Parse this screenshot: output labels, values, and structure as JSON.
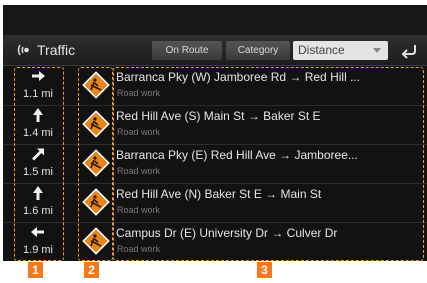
{
  "header": {
    "title": "Traffic",
    "title_icon": "radio-signal-icon",
    "on_route_label": "On Route",
    "category_label": "Category",
    "sort_dropdown": {
      "selected": "Distance"
    },
    "back_icon": "back-arrow-icon"
  },
  "incidents": [
    {
      "direction_icon": "arrow-right-icon",
      "distance": "1.1 mi",
      "road": "Barranca Pky (W) Jamboree Rd → Red Hill ...",
      "type": "Road work",
      "sign_icon": "road-work-sign-icon"
    },
    {
      "direction_icon": "arrow-up-icon",
      "distance": "1.4 mi",
      "road": "Red Hill Ave (S) Main St → Baker St E",
      "type": "Road work",
      "sign_icon": "road-work-sign-icon"
    },
    {
      "direction_icon": "arrow-up-right-icon",
      "distance": "1.5 mi",
      "road": "Barranca Pky (E) Red Hill Ave → Jamboree...",
      "type": "Road work",
      "sign_icon": "road-work-sign-icon"
    },
    {
      "direction_icon": "arrow-up-icon",
      "distance": "1.6 mi",
      "road": "Red Hill Ave (N) Baker St E → Main St",
      "type": "Road work",
      "sign_icon": "road-work-sign-icon"
    },
    {
      "direction_icon": "arrow-left-icon",
      "distance": "1.9 mi",
      "road": "Campus Dr (E) University Dr → Culver Dr",
      "type": "Road work",
      "sign_icon": "road-work-sign-icon"
    }
  ],
  "callouts": [
    "1",
    "2",
    "3"
  ],
  "colors": {
    "callout": "#f27a1d",
    "sign": "#e8861e",
    "background": "#121212"
  }
}
